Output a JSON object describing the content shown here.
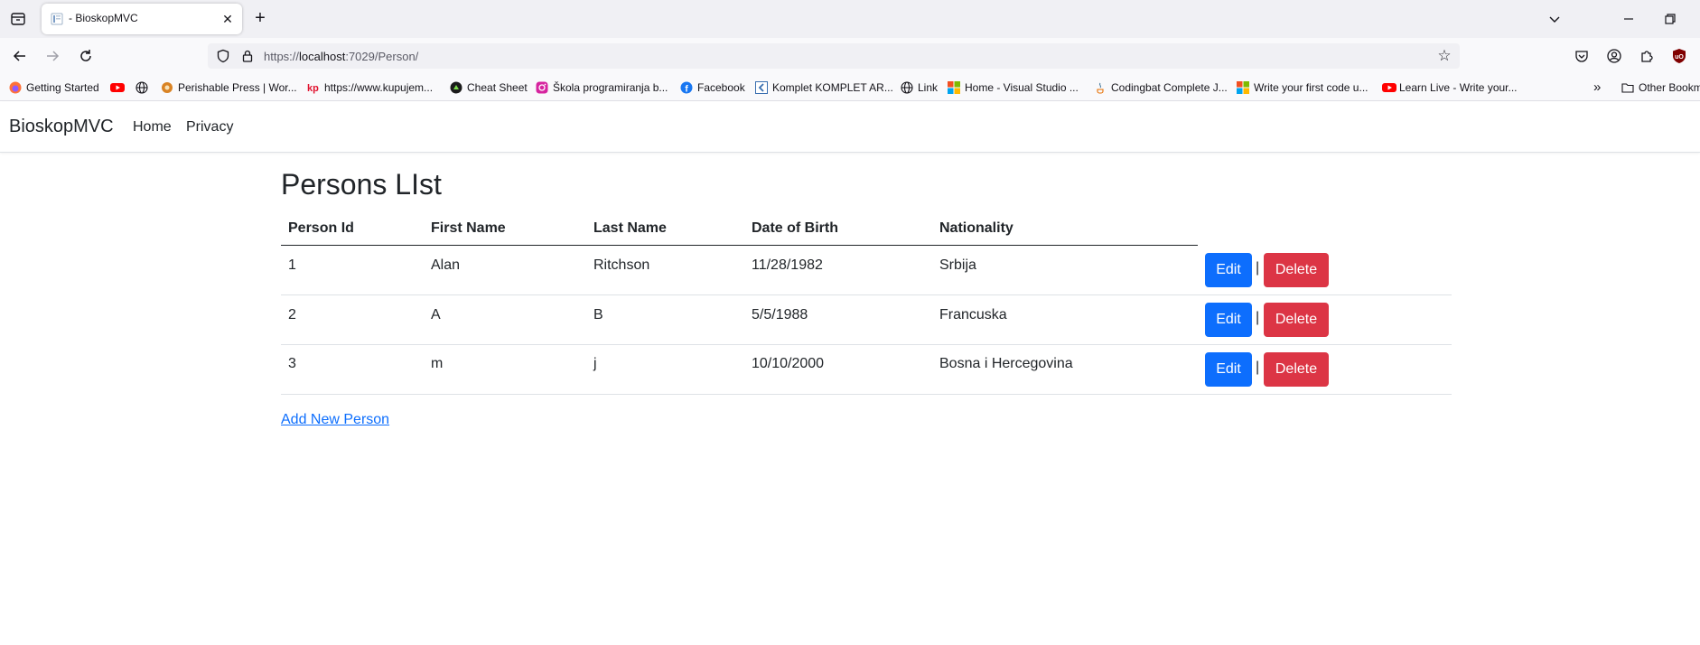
{
  "browser": {
    "tab_title": "- BioskopMVC",
    "url_scheme": "https://",
    "url_host": "localhost",
    "url_rest": ":7029/Person/",
    "bookmarks": [
      {
        "label": "Getting Started",
        "icon": "firefox-icon"
      },
      {
        "label": "",
        "icon": "youtube-icon"
      },
      {
        "label": "",
        "icon": "globe-icon"
      },
      {
        "label": "Perishable Press | Wor...",
        "icon": "perishable-press-icon"
      },
      {
        "label": "https://www.kupujem...",
        "icon": "kupujem-icon"
      },
      {
        "label": "Cheat Sheet",
        "icon": "cheat-sheet-icon"
      },
      {
        "label": "Škola programiranja b...",
        "icon": "instagram-icon"
      },
      {
        "label": "Facebook",
        "icon": "facebook-icon"
      },
      {
        "label": "Komplet KOMPLET AR...",
        "icon": "komplet-icon"
      },
      {
        "label": "Link",
        "icon": "globe-icon"
      },
      {
        "label": "Home - Visual Studio ...",
        "icon": "microsoft-icon"
      },
      {
        "label": "Codingbat Complete J...",
        "icon": "java-icon"
      },
      {
        "label": "Write your first code u...",
        "icon": "microsoft-icon"
      },
      {
        "label": "Learn Live - Write your...",
        "icon": "youtube-icon"
      }
    ],
    "other_bookmarks": "Other Bookm"
  },
  "site": {
    "brand": "BioskopMVC",
    "nav": [
      "Home",
      "Privacy"
    ]
  },
  "main": {
    "title": "Persons LIst",
    "columns": [
      "Person Id",
      "First Name",
      "Last Name",
      "Date of Birth",
      "Nationality"
    ],
    "rows": [
      [
        "1",
        "Alan",
        "Ritchson",
        "11/28/1982",
        "Srbija"
      ],
      [
        "2",
        "A",
        "B",
        "5/5/1988",
        "Francuska"
      ],
      [
        "3",
        "m",
        "j",
        "10/10/2000",
        "Bosna i Hercegovina"
      ]
    ],
    "edit_label": "Edit",
    "delete_label": "Delete",
    "separator": "|",
    "add_link": "Add New Person"
  },
  "colors": {
    "edit": "#0d6efd",
    "delete": "#dc3545",
    "link": "#0d6efd"
  }
}
